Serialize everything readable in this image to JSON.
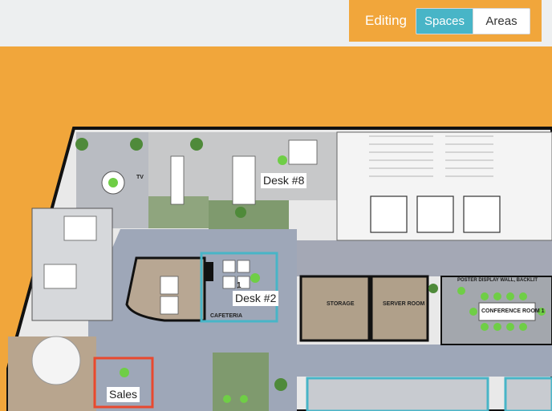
{
  "toolbar": {
    "mode_label": "Editing",
    "tabs": [
      {
        "label": "Spaces",
        "active": true
      },
      {
        "label": "Areas",
        "active": false
      }
    ]
  },
  "floorplan": {
    "spaces": [
      {
        "label": "Desk #8"
      },
      {
        "label": "Desk #2",
        "number": "1"
      },
      {
        "label": "Sales"
      }
    ],
    "room_labels": {
      "cafeteria": "CAFETERIA",
      "storage": "STORAGE",
      "server_room": "SERVER ROOM",
      "conference_room": "CONFERENCE ROOM 1",
      "poster_wall": "POSTER DISPLAY WALL, BACKLIT",
      "tv": "TV"
    }
  },
  "colors": {
    "accent_orange": "#f1a63b",
    "selected_blue": "#48b5c7",
    "selected_red": "#e8492f",
    "desk_green": "#6fce46"
  }
}
